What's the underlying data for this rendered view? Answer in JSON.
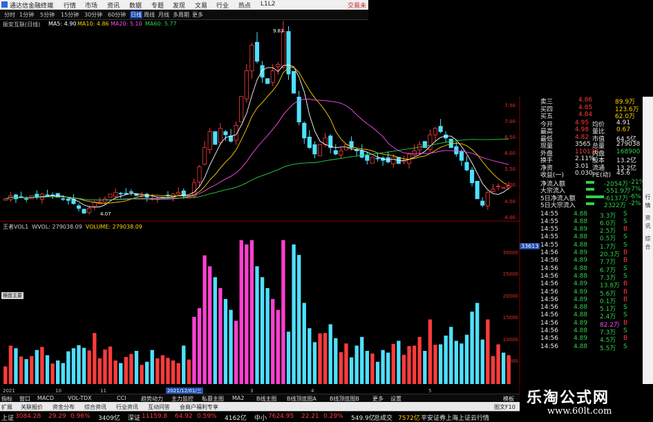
{
  "menubar": {
    "title": "通达信金融终端",
    "items": [
      "行情",
      "市场",
      "资讯",
      "数据",
      "专题",
      "发现",
      "文易",
      "行业",
      "热点",
      "L1L2"
    ],
    "right": "交易未"
  },
  "periods": {
    "items": [
      "分时",
      "1分钟",
      "5分钟",
      "15分钟",
      "30分钟",
      "60分钟",
      "日线",
      "周线",
      "月线",
      "多周期",
      "更多"
    ],
    "selected": "日线"
  },
  "main_chart": {
    "title": "振安互联(日线)",
    "ma": [
      {
        "name": "MA5",
        "value": "4.90",
        "color": "#ffffff"
      },
      {
        "name": "MA10",
        "value": "4.86",
        "color": "#ffd400"
      },
      {
        "name": "MA20",
        "value": "5.10",
        "color": "#ff4cf2"
      },
      {
        "name": "MA60",
        "value": "5.77",
        "color": "#2fd14a"
      }
    ],
    "high_label": "9.83",
    "low_label": "4.07",
    "price_axis": [
      "7.50",
      "7.00",
      "6.50",
      "6.00",
      "5.50",
      "5.00",
      "4.50",
      "4.00"
    ]
  },
  "volume_chart": {
    "title": "王者VOL1",
    "wvol": "WVOL: 279038.09",
    "volume": "VOLUME: 279038.09",
    "current_tag": "33613",
    "vol_axis": [
      "30000",
      "25000",
      "20000",
      "15000",
      "10000",
      "5000"
    ],
    "button": "横盘主要",
    "date_tag": "2021/12/01/三",
    "months": [
      "2021",
      "10",
      "11",
      "2",
      "3",
      "4",
      "5"
    ]
  },
  "chart_data": {
    "type": "candlestick",
    "title": "振安互联(日线)",
    "price_range": [
      4.0,
      9.83
    ],
    "close": [
      4.6,
      4.7,
      4.6,
      4.65,
      4.6,
      4.7,
      4.65,
      4.75,
      4.7,
      4.7,
      4.65,
      4.6,
      4.55,
      4.45,
      4.3,
      4.15,
      4.3,
      4.5,
      4.5,
      4.6,
      4.75,
      4.8,
      4.75,
      4.75,
      4.8,
      4.7,
      4.7,
      4.65,
      4.6,
      4.6,
      4.65,
      4.7,
      4.75,
      4.8,
      4.7,
      4.7,
      5.1,
      5.6,
      6.2,
      6.7,
      6.3,
      6.8,
      6.6,
      6.4,
      6.9,
      7.8,
      8.6,
      9.4,
      8.9,
      8.4,
      8.2,
      8.6,
      8.8,
      9.83,
      8.5,
      7.9,
      7.0,
      6.5,
      6.2,
      6.0,
      6.3,
      6.5,
      6.2,
      6.0,
      6.1,
      6.3,
      6.2,
      6.1,
      5.9,
      5.8,
      5.9,
      5.85,
      5.8,
      5.75,
      5.9,
      5.7,
      5.8,
      6.0,
      6.1,
      6.3,
      6.2,
      6.6,
      6.8,
      6.7,
      6.5,
      6.2,
      6.0,
      5.8,
      5.5,
      5.1,
      4.6,
      4.4,
      4.8,
      4.9,
      5.0,
      4.95,
      5.0
    ],
    "volume_range": [
      0,
      35000
    ]
  },
  "right_panel": {
    "order_rows": [
      {
        "label": "卖三",
        "price": "4.86",
        "vol": "89.9万"
      },
      {
        "label": "买四",
        "price": "4.85",
        "vol": "123.6万"
      },
      {
        "label": "买五",
        "price": "4.84",
        "vol": "62.0万"
      }
    ],
    "stats": [
      {
        "l1": "今开",
        "v1": "4.95",
        "l2": "均价",
        "v2": "4.91"
      },
      {
        "l1": "最高",
        "v1": "4.98",
        "l2": "量比",
        "v2": "0.67"
      },
      {
        "l1": "最低",
        "v1": "4.82",
        "l2": "市值",
        "v2": "64.5亿"
      },
      {
        "l1": "现量",
        "v1": "3565",
        "l2": "总量",
        "v2": "279038"
      },
      {
        "l1": "外盘",
        "v1": "110138",
        "l2": "内盘",
        "v2": "168900"
      },
      {
        "l1": "换手",
        "v1": "2.11%",
        "l2": "股本",
        "v2": "13.2亿"
      },
      {
        "l1": "净资",
        "v1": "3.01",
        "l2": "流通",
        "v2": "13.2亿"
      },
      {
        "l1": "收益(一)",
        "v1": "0.030",
        "l2": "PE(动)",
        "v2": "45.6"
      }
    ],
    "flows": [
      {
        "label": "净流入额",
        "val": "-2054万",
        "pct": "-21%"
      },
      {
        "label": "大宗流入",
        "val": "-551.9万",
        "pct": "-7%"
      },
      {
        "label": "5日净流入额",
        "val": "-6137万",
        "pct": "-6%"
      },
      {
        "label": "5日大宗流入",
        "val": "2322万",
        "pct": "-2%"
      }
    ],
    "ticks": [
      {
        "t": "14:55",
        "p": "4.88",
        "v": "3.3万",
        "s": "S"
      },
      {
        "t": "14:55",
        "p": "4.88",
        "v": "6.0万",
        "s": "S"
      },
      {
        "t": "14:55",
        "p": "4.89",
        "v": "2.5万",
        "s": "B"
      },
      {
        "t": "14:55",
        "p": "4.88",
        "v": "0.5万",
        "s": "S"
      },
      {
        "t": "14:55",
        "p": "4.88",
        "v": "1.7万",
        "s": "S"
      },
      {
        "t": "14:56",
        "p": "4.89",
        "v": "20.3万",
        "s": "B"
      },
      {
        "t": "14:56",
        "p": "4.89",
        "v": "7.7万",
        "s": "B"
      },
      {
        "t": "14:56",
        "p": "4.88",
        "v": "6.7万",
        "s": "S"
      },
      {
        "t": "14:56",
        "p": "4.88",
        "v": "7.3万",
        "s": "S"
      },
      {
        "t": "14:56",
        "p": "4.89",
        "v": "13.8万",
        "s": "B"
      },
      {
        "t": "14:56",
        "p": "4.89",
        "v": "5.6万",
        "s": "B"
      },
      {
        "t": "14:56",
        "p": "4.89",
        "v": "0.1万",
        "s": "B"
      },
      {
        "t": "14:56",
        "p": "4.88",
        "v": "5.1万",
        "s": "S"
      },
      {
        "t": "14:56",
        "p": "4.88",
        "v": "2.4万",
        "s": "S"
      },
      {
        "t": "14:56",
        "p": "4.89",
        "v": "82.2万",
        "s": "B"
      },
      {
        "t": "14:56",
        "p": "4.88",
        "v": "7.3万",
        "s": "S"
      },
      {
        "t": "14:56",
        "p": "4.89",
        "v": "4.5万",
        "s": "B"
      },
      {
        "t": "14:56",
        "p": "4.88",
        "v": "5.5万",
        "s": "S"
      }
    ]
  },
  "indicator_tabs": [
    "指标",
    "窗口",
    "MACD",
    "VOL-TDX",
    "CCI",
    "趋势动力",
    "主力监控",
    "私募主图",
    "MA2",
    "B线主图",
    "B线顶底图A",
    "B线顶底图B",
    "更多",
    "设置"
  ],
  "indicator_right": "模板",
  "bottom_tabs": [
    "扩展",
    "关联报价",
    "资金分布",
    "综合资讯",
    "行业资讯",
    "互动问答",
    "会商户福利专享"
  ],
  "bottom_right": "图文F10",
  "status": [
    {
      "label": "上证",
      "val": "3084.28",
      "chg": "29.29",
      "pct": "0.96%",
      "amt": "3409亿"
    },
    {
      "label": "深证",
      "val": "11159.8",
      "chg": "64.92",
      "pct": "0.59%",
      "amt": "4162亿"
    },
    {
      "label": "中小",
      "val": "7624.95",
      "chg": "22.21",
      "pct": "0.29%",
      "amt": "549.9亿"
    }
  ],
  "status_total_label": "总成交",
  "status_total": "7572亿",
  "status_broker": "平安证券上海上证云行情",
  "side_toolbar": [
    "行",
    "情",
    "资",
    "讯",
    "综",
    "合"
  ],
  "watermark": {
    "line1": "乐淘公式网",
    "line2": "www.60lt.com"
  },
  "colors": {
    "up": "#ff3b3b",
    "down": "#4fe0ff",
    "ma5": "#ffffff",
    "ma10": "#ffd400",
    "ma20": "#ff4cf2",
    "ma60": "#2fd14a",
    "grid": "#8b0000"
  }
}
